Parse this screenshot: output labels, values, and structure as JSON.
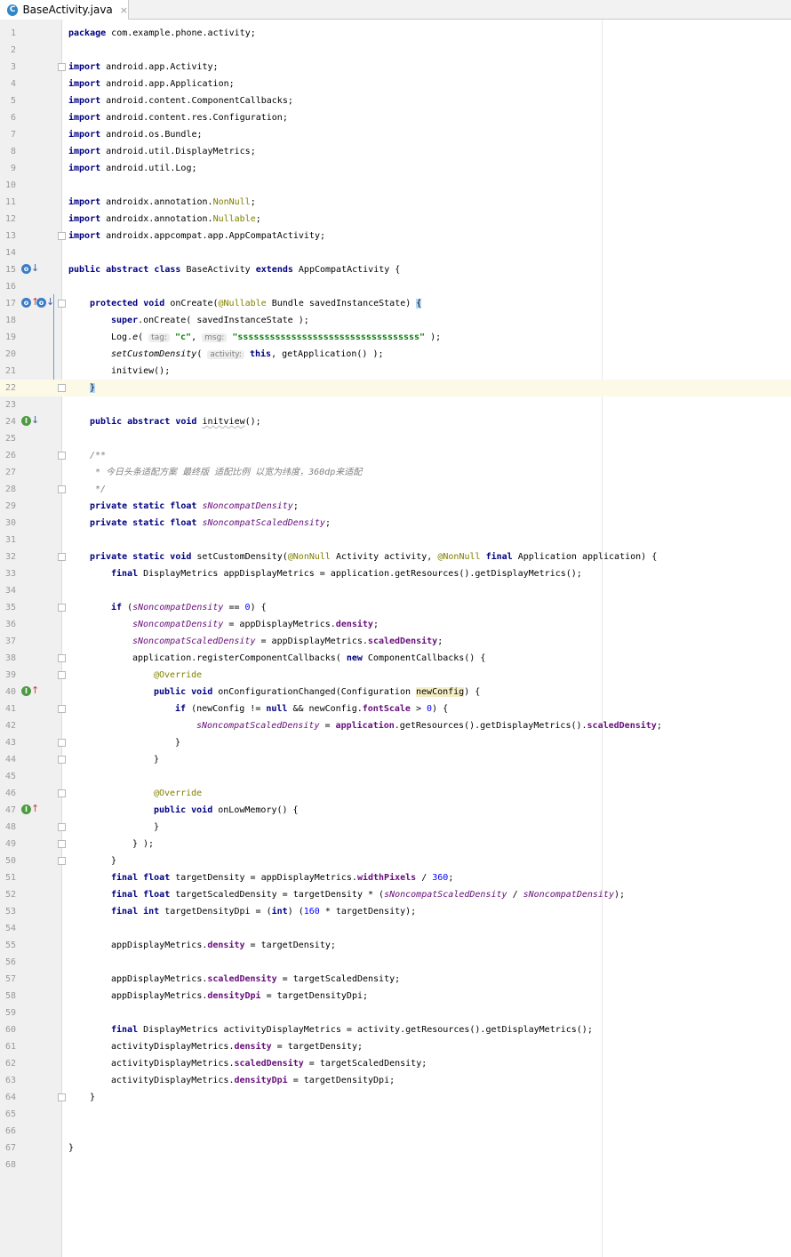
{
  "tab": {
    "icon": "C",
    "filename": "BaseActivity.java",
    "close": "×"
  },
  "lines": [
    {
      "n": "1",
      "parts": [
        [
          "package",
          "kw"
        ],
        [
          " com.example.phone.activity;",
          ""
        ]
      ]
    },
    {
      "n": "2",
      "parts": []
    },
    {
      "n": "3",
      "fold": true,
      "parts": [
        [
          "import",
          "kw"
        ],
        [
          " android.app.Activity;",
          ""
        ]
      ]
    },
    {
      "n": "4",
      "parts": [
        [
          "import",
          "kw"
        ],
        [
          " android.app.Application;",
          ""
        ]
      ]
    },
    {
      "n": "5",
      "parts": [
        [
          "import",
          "kw"
        ],
        [
          " android.content.ComponentCallbacks;",
          ""
        ]
      ]
    },
    {
      "n": "6",
      "parts": [
        [
          "import",
          "kw"
        ],
        [
          " android.content.res.Configuration;",
          ""
        ]
      ]
    },
    {
      "n": "7",
      "parts": [
        [
          "import",
          "kw"
        ],
        [
          " android.os.Bundle;",
          ""
        ]
      ]
    },
    {
      "n": "8",
      "parts": [
        [
          "import",
          "kw"
        ],
        [
          " android.util.DisplayMetrics;",
          ""
        ]
      ]
    },
    {
      "n": "9",
      "parts": [
        [
          "import",
          "kw"
        ],
        [
          " android.util.Log;",
          ""
        ]
      ]
    },
    {
      "n": "10",
      "parts": []
    },
    {
      "n": "11",
      "parts": [
        [
          "import",
          "kw"
        ],
        [
          " androidx.annotation.",
          ""
        ],
        [
          "NonNull",
          "ann"
        ],
        [
          ";",
          ""
        ]
      ]
    },
    {
      "n": "12",
      "parts": [
        [
          "import",
          "kw"
        ],
        [
          " androidx.annotation.",
          ""
        ],
        [
          "Nullable",
          "ann"
        ],
        [
          ";",
          ""
        ]
      ]
    },
    {
      "n": "13",
      "fold": true,
      "parts": [
        [
          "import",
          "kw"
        ],
        [
          " androidx.appcompat.app.AppCompatActivity;",
          ""
        ]
      ]
    },
    {
      "n": "14",
      "parts": []
    },
    {
      "n": "15",
      "icons": [
        {
          "t": "o",
          "c": "blue",
          "arrow": "↓",
          "ac": "blue"
        }
      ],
      "parts": [
        [
          "public abstract class",
          "kw"
        ],
        [
          " BaseActivity ",
          ""
        ],
        [
          "extends",
          "kw"
        ],
        [
          " AppCompatActivity {",
          ""
        ]
      ]
    },
    {
      "n": "16",
      "parts": []
    },
    {
      "n": "17",
      "fold": true,
      "icons": [
        {
          "t": "o",
          "c": "blue",
          "arrow": "↑",
          "ac": "red"
        },
        {
          "t": "o",
          "c": "blue",
          "arrow": "↓",
          "ac": "blue"
        }
      ],
      "indent": 1,
      "parts": [
        [
          "protected void",
          "kw"
        ],
        [
          " onCreate(",
          ""
        ],
        [
          "@Nullable",
          "ann"
        ],
        [
          " Bundle savedInstanceState) ",
          ""
        ],
        [
          "{",
          "brace"
        ]
      ]
    },
    {
      "n": "18",
      "indent": 2,
      "parts": [
        [
          "super",
          "kw"
        ],
        [
          ".onCreate( savedInstanceState );",
          ""
        ]
      ]
    },
    {
      "n": "19",
      "indent": 2,
      "parts": [
        [
          "Log.",
          ""
        ],
        [
          "e",
          "ital"
        ],
        [
          "( ",
          ""
        ],
        [
          "tag:",
          "hint"
        ],
        [
          " ",
          ""
        ],
        [
          "\"c\"",
          "str"
        ],
        [
          ", ",
          ""
        ],
        [
          "msg:",
          "hint"
        ],
        [
          " ",
          ""
        ],
        [
          "\"ssssssssssssssssssssssssssssssssss\"",
          "str"
        ],
        [
          " );",
          ""
        ]
      ]
    },
    {
      "n": "20",
      "indent": 2,
      "parts": [
        [
          "setCustomDensity",
          "ital"
        ],
        [
          "( ",
          ""
        ],
        [
          "activity:",
          "hint"
        ],
        [
          " ",
          ""
        ],
        [
          "this",
          "kw"
        ],
        [
          ", getApplication() );",
          ""
        ]
      ]
    },
    {
      "n": "21",
      "indent": 2,
      "parts": [
        [
          "initview();",
          ""
        ]
      ]
    },
    {
      "n": "22",
      "current": true,
      "fold": true,
      "indent": 1,
      "parts": [
        [
          "}",
          "brace"
        ]
      ]
    },
    {
      "n": "23",
      "parts": []
    },
    {
      "n": "24",
      "icons": [
        {
          "t": "I",
          "c": "green",
          "arrow": "↓",
          "ac": "blue"
        }
      ],
      "indent": 1,
      "parts": [
        [
          "public abstract void",
          "kw"
        ],
        [
          " ",
          ""
        ],
        [
          "initview",
          "wavy"
        ],
        [
          "();",
          ""
        ]
      ]
    },
    {
      "n": "25",
      "parts": []
    },
    {
      "n": "26",
      "fold": true,
      "indent": 1,
      "parts": [
        [
          "/**",
          "cm"
        ]
      ]
    },
    {
      "n": "27",
      "indent": 1,
      "parts": [
        [
          " * 今日头条适配方案 最终版 适配比例 以宽为纬度，360dp来适配",
          "cm"
        ]
      ]
    },
    {
      "n": "28",
      "fold": true,
      "indent": 1,
      "parts": [
        [
          " */",
          "cm"
        ]
      ]
    },
    {
      "n": "29",
      "indent": 1,
      "parts": [
        [
          "private static float",
          "kw"
        ],
        [
          " ",
          ""
        ],
        [
          "sNoncompatDensity",
          "st"
        ],
        [
          ";",
          ""
        ]
      ]
    },
    {
      "n": "30",
      "indent": 1,
      "parts": [
        [
          "private static float",
          "kw"
        ],
        [
          " ",
          ""
        ],
        [
          "sNoncompatScaledDensity",
          "st"
        ],
        [
          ";",
          ""
        ]
      ]
    },
    {
      "n": "31",
      "parts": []
    },
    {
      "n": "32",
      "fold": true,
      "indent": 1,
      "parts": [
        [
          "private static void",
          "kw"
        ],
        [
          " setCustomDensity(",
          ""
        ],
        [
          "@NonNull",
          "ann"
        ],
        [
          " Activity activity, ",
          ""
        ],
        [
          "@NonNull",
          "ann"
        ],
        [
          " ",
          ""
        ],
        [
          "final",
          "kw"
        ],
        [
          " Application application) {",
          ""
        ]
      ]
    },
    {
      "n": "33",
      "indent": 2,
      "parts": [
        [
          "final",
          "kw"
        ],
        [
          " DisplayMetrics appDisplayMetrics = application.getResources().getDisplayMetrics();",
          ""
        ]
      ]
    },
    {
      "n": "34",
      "parts": []
    },
    {
      "n": "35",
      "fold": true,
      "indent": 2,
      "parts": [
        [
          "if",
          "kw"
        ],
        [
          " (",
          ""
        ],
        [
          "sNoncompatDensity",
          "st"
        ],
        [
          " == ",
          ""
        ],
        [
          "0",
          "num"
        ],
        [
          ") {",
          ""
        ]
      ]
    },
    {
      "n": "36",
      "indent": 3,
      "parts": [
        [
          "sNoncompatDensity",
          "st"
        ],
        [
          " = appDisplayMetrics.",
          ""
        ],
        [
          "density",
          "fld"
        ],
        [
          ";",
          ""
        ]
      ]
    },
    {
      "n": "37",
      "indent": 3,
      "parts": [
        [
          "sNoncompatScaledDensity",
          "st"
        ],
        [
          " = appDisplayMetrics.",
          ""
        ],
        [
          "scaledDensity",
          "fld"
        ],
        [
          ";",
          ""
        ]
      ]
    },
    {
      "n": "38",
      "fold": true,
      "indent": 3,
      "parts": [
        [
          "application.registerComponentCallbacks( ",
          ""
        ],
        [
          "new",
          "kw"
        ],
        [
          " ComponentCallbacks() {",
          ""
        ]
      ]
    },
    {
      "n": "39",
      "fold": true,
      "indent": 4,
      "parts": [
        [
          "@Override",
          "ann"
        ]
      ]
    },
    {
      "n": "40",
      "icons": [
        {
          "t": "I",
          "c": "green",
          "arrow": "↑",
          "ac": "red"
        }
      ],
      "indent": 4,
      "parts": [
        [
          "public void",
          "kw"
        ],
        [
          " onConfigurationChanged(Configuration ",
          ""
        ],
        [
          "newConfig",
          "hl"
        ],
        [
          ") {",
          ""
        ]
      ]
    },
    {
      "n": "41",
      "fold": true,
      "indent": 5,
      "parts": [
        [
          "if",
          "kw"
        ],
        [
          " (newConfig != ",
          ""
        ],
        [
          "null",
          "kw"
        ],
        [
          " && newConfig.",
          ""
        ],
        [
          "fontScale",
          "fld"
        ],
        [
          " > ",
          ""
        ],
        [
          "0",
          "num"
        ],
        [
          ") {",
          ""
        ]
      ]
    },
    {
      "n": "42",
      "indent": 6,
      "parts": [
        [
          "sNoncompatScaledDensity",
          "st"
        ],
        [
          " = ",
          ""
        ],
        [
          "application",
          "fld"
        ],
        [
          ".getResources().getDisplayMetrics().",
          ""
        ],
        [
          "scaledDensity",
          "fld"
        ],
        [
          ";",
          ""
        ]
      ]
    },
    {
      "n": "43",
      "fold": true,
      "indent": 5,
      "parts": [
        [
          "}",
          ""
        ]
      ]
    },
    {
      "n": "44",
      "fold": true,
      "indent": 4,
      "parts": [
        [
          "}",
          ""
        ]
      ]
    },
    {
      "n": "45",
      "parts": []
    },
    {
      "n": "46",
      "fold": true,
      "indent": 4,
      "parts": [
        [
          "@Override",
          "ann"
        ]
      ]
    },
    {
      "n": "47",
      "icons": [
        {
          "t": "I",
          "c": "green",
          "arrow": "↑",
          "ac": "red"
        }
      ],
      "indent": 4,
      "parts": [
        [
          "public void",
          "kw"
        ],
        [
          " onLowMemory() {",
          ""
        ]
      ]
    },
    {
      "n": "48",
      "fold": true,
      "indent": 4,
      "parts": [
        [
          "}",
          ""
        ]
      ]
    },
    {
      "n": "49",
      "fold": true,
      "indent": 3,
      "parts": [
        [
          "} );",
          ""
        ]
      ]
    },
    {
      "n": "50",
      "fold": true,
      "indent": 2,
      "parts": [
        [
          "}",
          ""
        ]
      ]
    },
    {
      "n": "51",
      "indent": 2,
      "parts": [
        [
          "final float",
          "kw"
        ],
        [
          " targetDensity = appDisplayMetrics.",
          ""
        ],
        [
          "widthPixels",
          "fld"
        ],
        [
          " / ",
          ""
        ],
        [
          "360",
          "num"
        ],
        [
          ";",
          ""
        ]
      ]
    },
    {
      "n": "52",
      "indent": 2,
      "parts": [
        [
          "final float",
          "kw"
        ],
        [
          " targetScaledDensity = targetDensity * (",
          ""
        ],
        [
          "sNoncompatScaledDensity",
          "st"
        ],
        [
          " / ",
          ""
        ],
        [
          "sNoncompatDensity",
          "st"
        ],
        [
          ");",
          ""
        ]
      ]
    },
    {
      "n": "53",
      "indent": 2,
      "parts": [
        [
          "final int",
          "kw"
        ],
        [
          " targetDensityDpi = (",
          ""
        ],
        [
          "int",
          "kw"
        ],
        [
          ") (",
          ""
        ],
        [
          "160",
          "num"
        ],
        [
          " * targetDensity);",
          ""
        ]
      ]
    },
    {
      "n": "54",
      "parts": []
    },
    {
      "n": "55",
      "indent": 2,
      "parts": [
        [
          "appDisplayMetrics.",
          ""
        ],
        [
          "density",
          "fld"
        ],
        [
          " = targetDensity;",
          ""
        ]
      ]
    },
    {
      "n": "56",
      "parts": []
    },
    {
      "n": "57",
      "indent": 2,
      "parts": [
        [
          "appDisplayMetrics.",
          ""
        ],
        [
          "scaledDensity",
          "fld"
        ],
        [
          " = targetScaledDensity;",
          ""
        ]
      ]
    },
    {
      "n": "58",
      "indent": 2,
      "parts": [
        [
          "appDisplayMetrics.",
          ""
        ],
        [
          "densityDpi",
          "fld"
        ],
        [
          " = targetDensityDpi;",
          ""
        ]
      ]
    },
    {
      "n": "59",
      "parts": []
    },
    {
      "n": "60",
      "indent": 2,
      "parts": [
        [
          "final",
          "kw"
        ],
        [
          " DisplayMetrics activityDisplayMetrics = activity.getResources().getDisplayMetrics();",
          ""
        ]
      ]
    },
    {
      "n": "61",
      "indent": 2,
      "parts": [
        [
          "activityDisplayMetrics.",
          ""
        ],
        [
          "density",
          "fld"
        ],
        [
          " = targetDensity;",
          ""
        ]
      ]
    },
    {
      "n": "62",
      "indent": 2,
      "parts": [
        [
          "activityDisplayMetrics.",
          ""
        ],
        [
          "scaledDensity",
          "fld"
        ],
        [
          " = targetScaledDensity;",
          ""
        ]
      ]
    },
    {
      "n": "63",
      "indent": 2,
      "parts": [
        [
          "activityDisplayMetrics.",
          ""
        ],
        [
          "densityDpi",
          "fld"
        ],
        [
          " = targetDensityDpi;",
          ""
        ]
      ]
    },
    {
      "n": "64",
      "fold": true,
      "indent": 1,
      "parts": [
        [
          "}",
          ""
        ]
      ]
    },
    {
      "n": "65",
      "parts": []
    },
    {
      "n": "66",
      "parts": []
    },
    {
      "n": "67",
      "parts": [
        [
          "}",
          ""
        ]
      ]
    },
    {
      "n": "68",
      "parts": []
    }
  ]
}
